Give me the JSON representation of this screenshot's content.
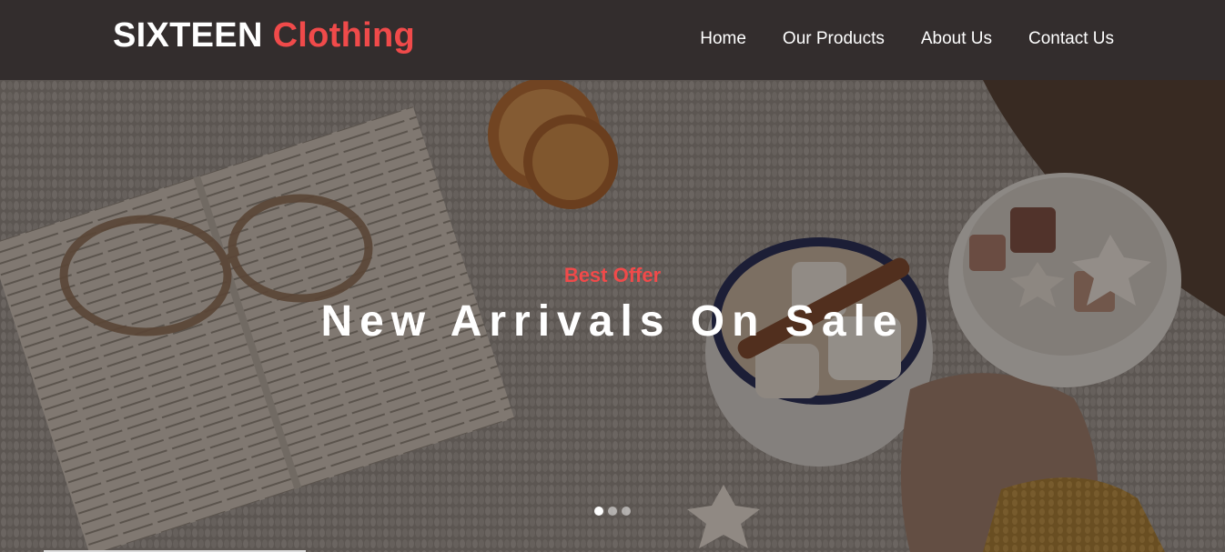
{
  "brand": {
    "name": "SIXTEEN",
    "accent": "Clothing",
    "accent_color": "#f04a4a"
  },
  "nav": {
    "items": [
      {
        "label": "Home"
      },
      {
        "label": "Our Products"
      },
      {
        "label": "About Us"
      },
      {
        "label": "Contact Us"
      }
    ]
  },
  "hero": {
    "kicker": "Best Offer",
    "title": "New Arrivals On Sale",
    "slides": {
      "count": 3,
      "active_index": 0
    }
  },
  "colors": {
    "navbar_bg": "#332d2d",
    "accent": "#f04a4a",
    "text": "#ffffff"
  }
}
